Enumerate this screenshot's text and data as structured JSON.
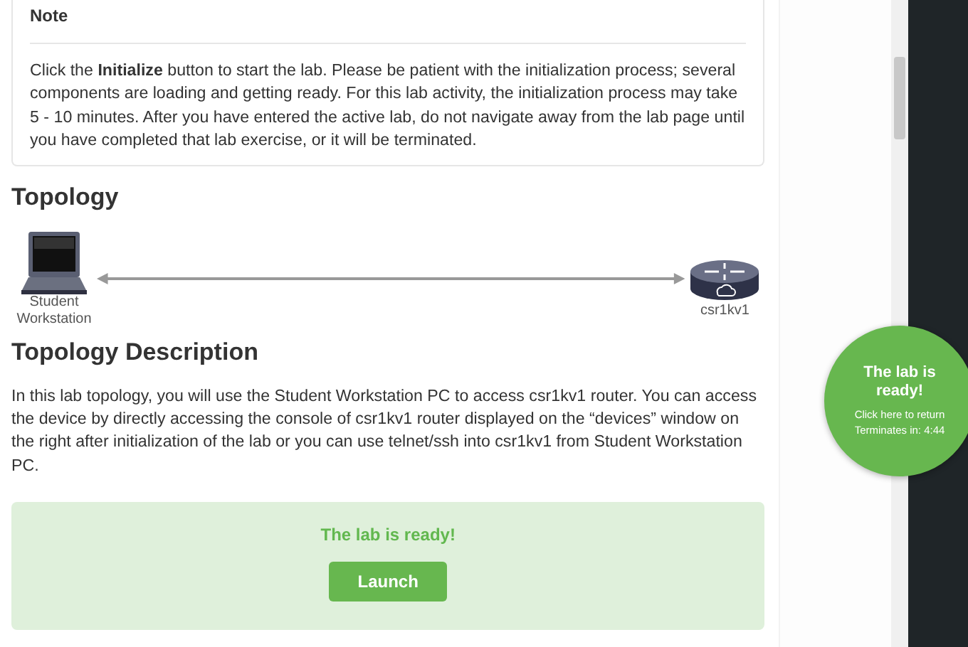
{
  "note": {
    "title": "Note",
    "text": "Click the **Initialize** button to start the lab. Please be patient with the initialization process; several components are loading and getting ready. For this lab activity, the initialization process may take 5 - 10 minutes. After you have entered the active lab, do not navigate away from the lab page until you have completed that lab exercise, or it will be terminated."
  },
  "topology": {
    "heading": "Topology",
    "nodes": [
      {
        "kind": "laptop",
        "label": "Student Workstation"
      },
      {
        "kind": "router",
        "label": "csr1kv1"
      }
    ]
  },
  "description": {
    "heading": "Topology Description",
    "text": "In this lab topology, you will use the Student Workstation PC to access csr1kv1 router. You can access the device by directly accessing the console of csr1kv1 router displayed on the “devices” window on the right after initialization of the lab or you can use telnet/ssh into csr1kv1 from Student Workstation PC."
  },
  "ready_panel": {
    "message": "The lab is ready!",
    "button": "Launch"
  },
  "status_bubble": {
    "title": "The lab is ready!",
    "link": "Click here to return",
    "timer": "Terminates in: 4:44"
  }
}
